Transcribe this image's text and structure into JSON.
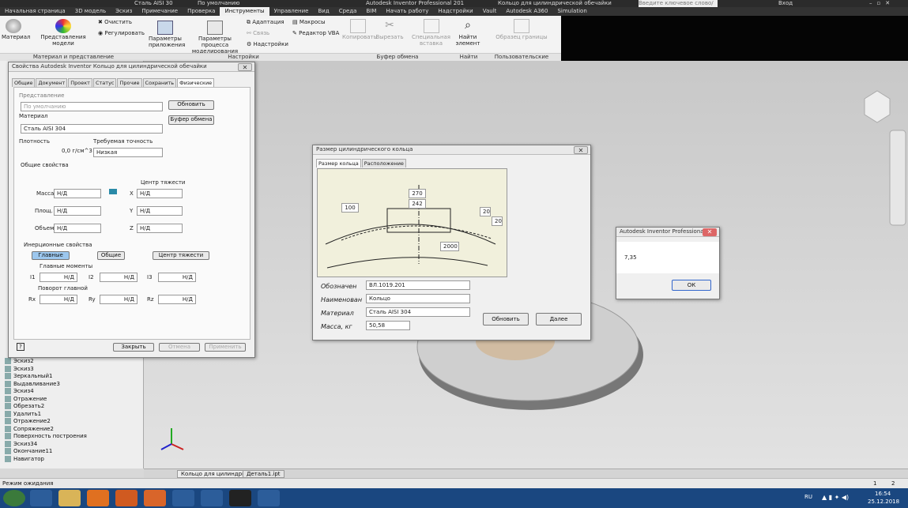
{
  "app": {
    "title": "Autodesk Inventor Professional 201",
    "doc_title": "Кольцо для цилиндрической обечайки",
    "quick_material": "Сталь AISI 30",
    "quick_appearance": "По умолчанию",
    "search_placeholder": "Введите ключевое слово/фразу",
    "user": "Вход"
  },
  "menu": [
    "Начальная страница",
    "3D модель",
    "Эскиз",
    "Примечание",
    "Проверка",
    "Инструменты",
    "Управление",
    "Вид",
    "Среда",
    "BIM",
    "Начать работу",
    "Надстройки",
    "Vault",
    "Autodesk A360",
    "Simulation"
  ],
  "menu_active": "Инструменты",
  "ribbon": {
    "buttons": {
      "material": "Материал",
      "appearance": "Представления модели",
      "clear": "Очистить",
      "adjust": "Регулировать",
      "app_options": "Параметры приложения",
      "doc_settings": "Параметры процесса моделирования",
      "adaptive": "Адаптация",
      "link": "Связь",
      "add_ins": "Надстройки",
      "macros": "Макросы",
      "vba": "Редактор VBA",
      "copy": "Копировать",
      "cut": "Вырезать",
      "paste_special": "Специальная вставка",
      "find": "Найти элемент",
      "model_border": "Образец границы"
    },
    "groups": [
      "Материал и представление",
      "Настройки",
      "Буфер обмена",
      "Найти",
      "Пользовательские команды"
    ]
  },
  "browser_tree": [
    "Эскиз2",
    "Эскиз3",
    "Зеркальный1",
    "Выдавливание3",
    "Эскиз4",
    "Отражение",
    "Обрезать2",
    "Удалить1",
    "Отражение2",
    "Сопряжение2",
    "Поверхность построения",
    "Эскиз34",
    "Окончание11",
    "Навигатор"
  ],
  "doc_tabs": [
    "Кольцо для цилиндрической ...",
    "Деталь1.ipt"
  ],
  "status": {
    "left": "Режим ожидания",
    "pages": [
      "1",
      "2"
    ]
  },
  "taskbar": {
    "lang": "RU",
    "time": "16:54",
    "date": "25.12.2018"
  },
  "props": {
    "title": "Свойства Autodesk Inventor Кольцо для цилиндрической обечайки",
    "tabs": [
      "Общие",
      "Документ",
      "Проект",
      "Статус",
      "Прочие",
      "Сохранить",
      "Физические"
    ],
    "appearance_label": "Представление",
    "appearance_value": "По умолчанию",
    "update_btn": "Обновить",
    "clipboard_btn": "Буфер обмена",
    "material_label": "Материал",
    "material_value": "Сталь AISI 304",
    "density_label": "Плотность",
    "density_value": "0,0 г/см^3",
    "accuracy_label": "Требуемая точность",
    "accuracy_value": "Низкая",
    "general_label": "Общие свойства",
    "cog_label": "Центр тяжести",
    "mass_label": "Масса",
    "area_label": "Площ.",
    "volume_label": "Объем",
    "na": "Н/Д",
    "x": "X",
    "y": "Y",
    "z": "Z",
    "inertia_label": "Инерционные свойства",
    "principal_btn": "Главные",
    "global_btn": "Общие",
    "cog_btn": "Центр тяжести",
    "principal_moments": "Главные моменты",
    "i1": "I1",
    "i2": "I2",
    "i3": "I3",
    "rotation": "Поворот главной",
    "rx": "Rx",
    "ry": "Ry",
    "rz": "Rz",
    "close_btn": "Закрыть",
    "cancel_btn": "Отмена",
    "apply_btn": "Применить"
  },
  "ringdlg": {
    "title": "Размер цилиндрического кольца",
    "tabs": [
      "Размер кольца",
      "Расположение"
    ],
    "dims": [
      "270",
      "242",
      "20",
      "100",
      "20",
      "2000"
    ],
    "designation_label": "Обозначен",
    "designation_value": "ВЛ.1019.201",
    "name_label": "Наименован",
    "name_value": "Кольцо",
    "material_label": "Материал",
    "material_value": "Сталь AISI 304",
    "mass_label": "Масса, кг",
    "mass_value": "50,58",
    "refresh_btn": "Обновить",
    "next_btn": "Далее"
  },
  "msgbox": {
    "title": "Autodesk Inventor Professional",
    "value": "7,35",
    "ok": "ОК"
  }
}
